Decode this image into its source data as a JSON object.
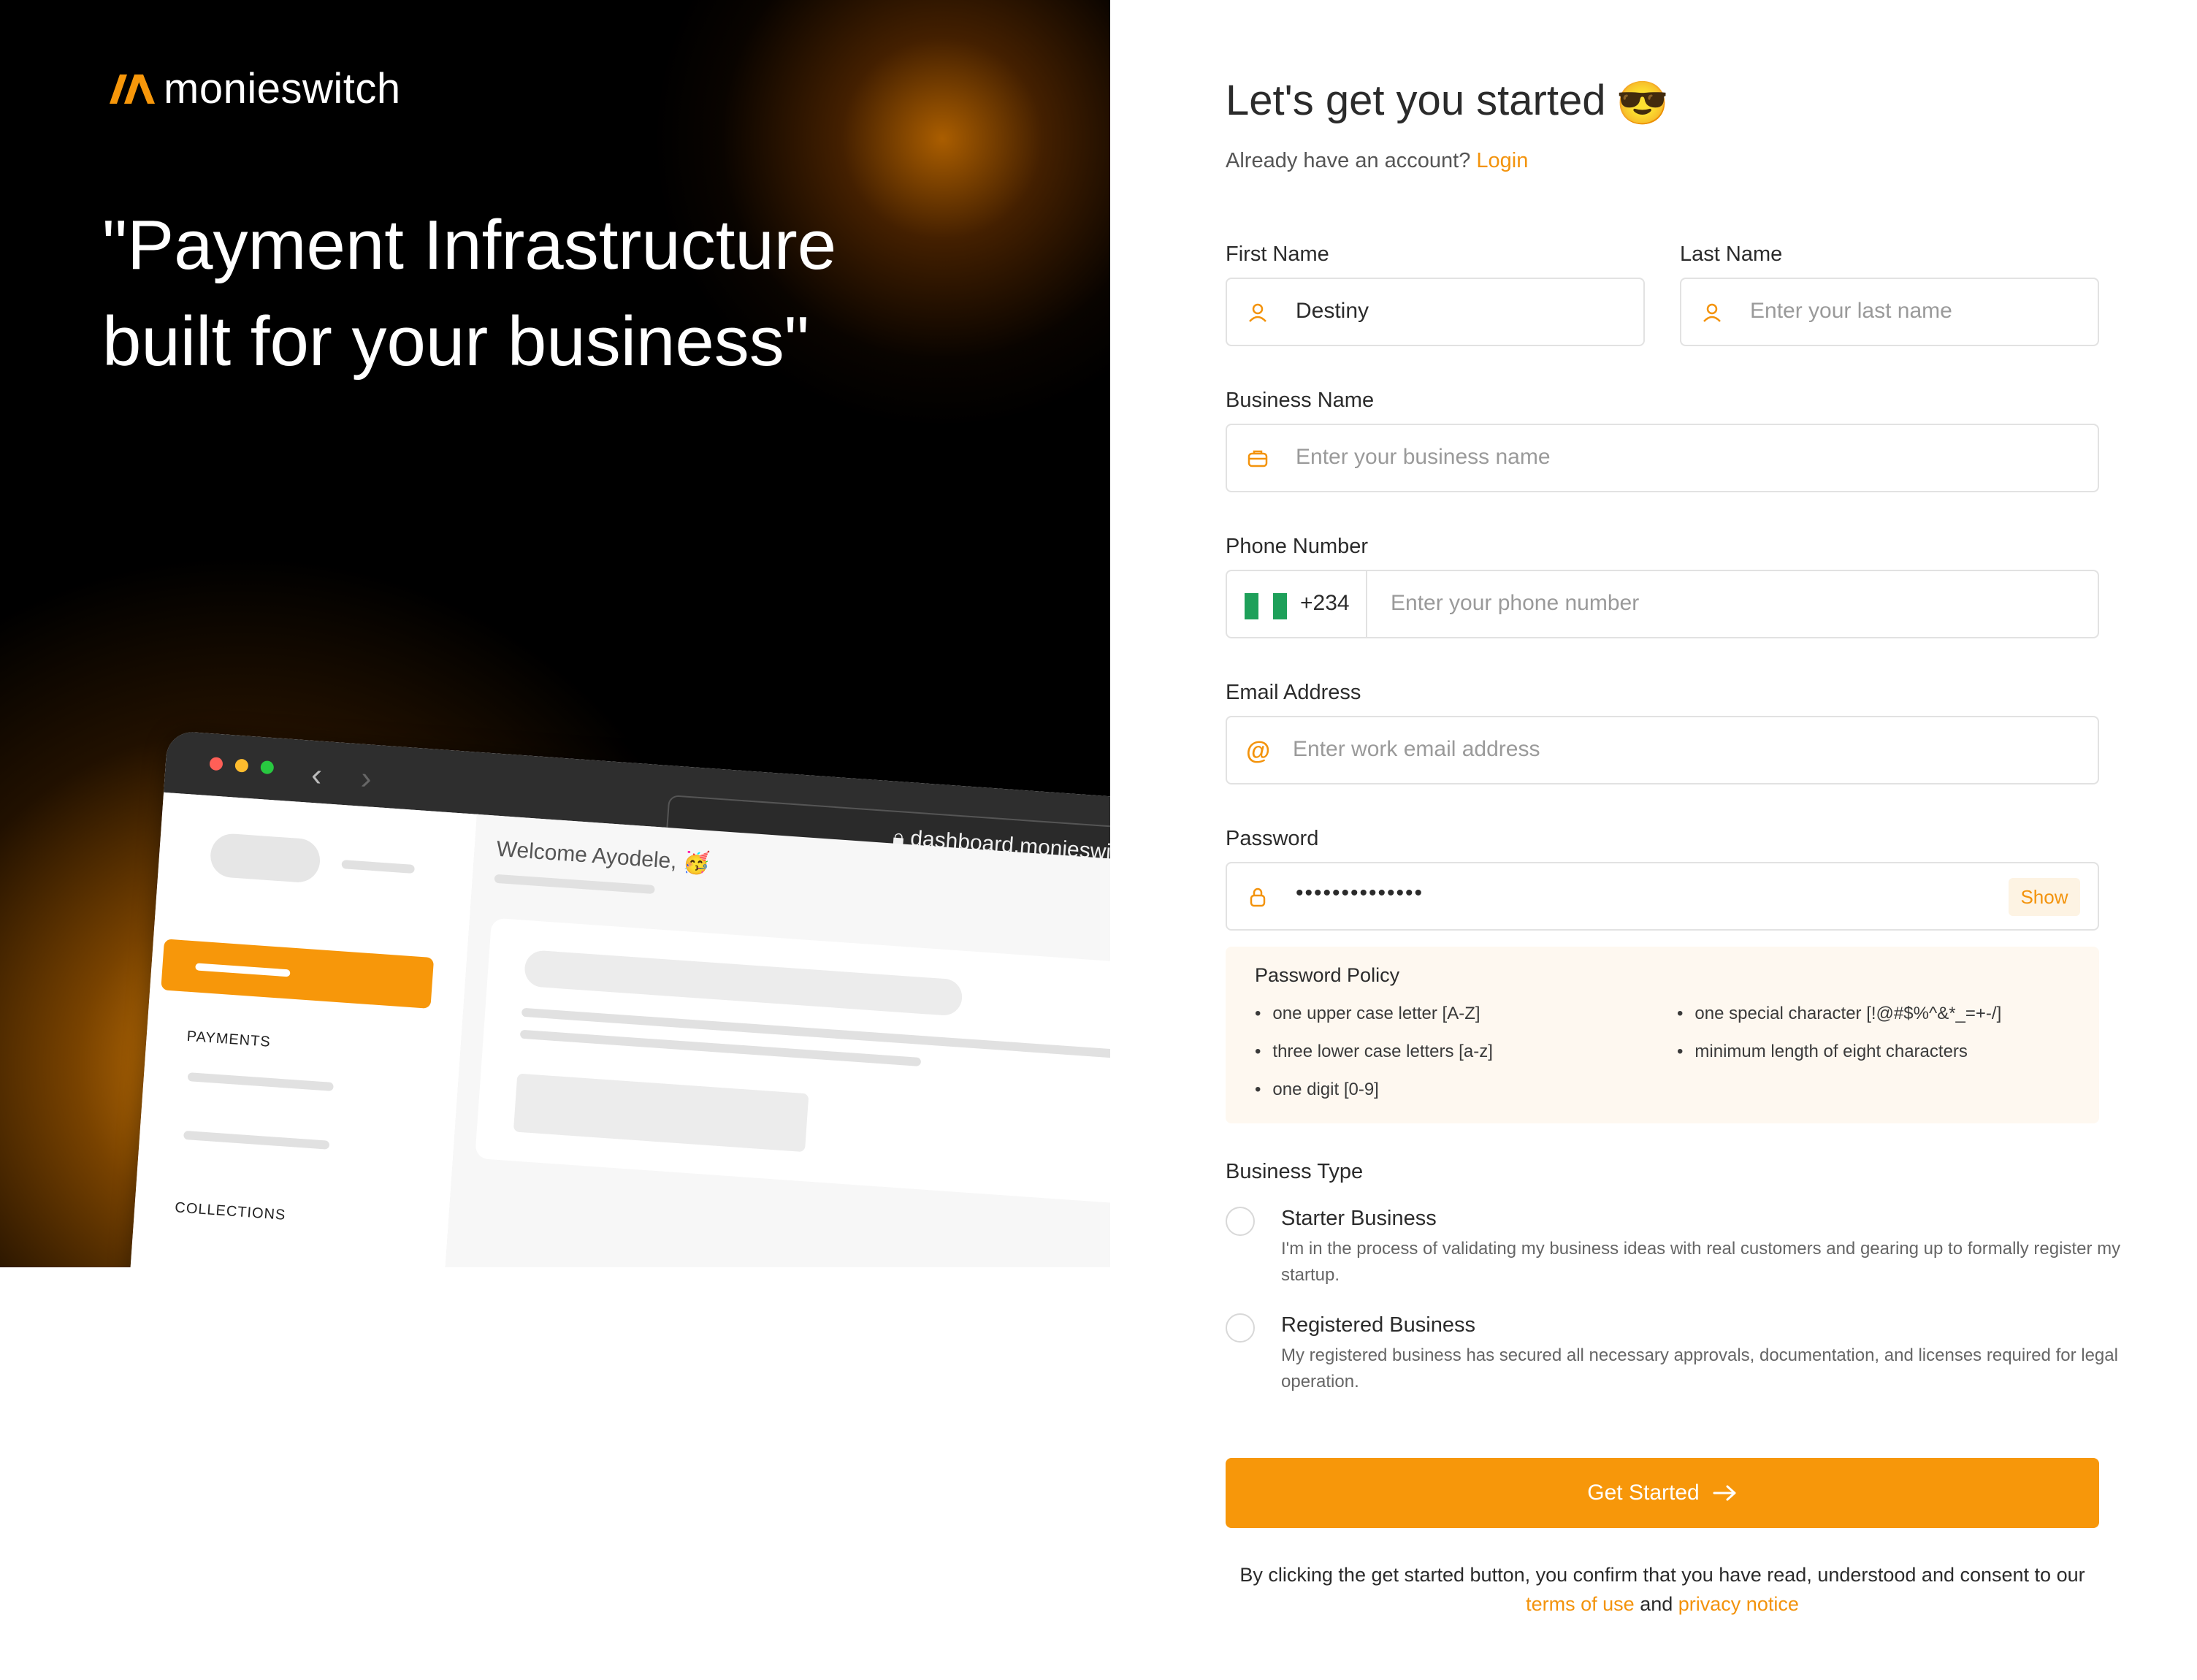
{
  "brand": {
    "name": "monieswitch",
    "accent": "#f7970a"
  },
  "hero": {
    "headline_line1": "\"Payment Infrastructure",
    "headline_line2": "built for your business\""
  },
  "mockup": {
    "url": "dashboard.monieswi",
    "welcome": "Welcome Ayodele, 🥳",
    "section1": "PAYMENTS",
    "section2": "COLLECTIONS"
  },
  "form": {
    "title": "Let's get you started",
    "title_emoji": "😎",
    "login_prompt": "Already have an account?",
    "login_link": "Login",
    "first_name": {
      "label": "First Name",
      "value": "Destiny"
    },
    "last_name": {
      "label": "Last Name",
      "placeholder": "Enter your last name"
    },
    "business_name": {
      "label": "Business Name",
      "placeholder": "Enter your business name"
    },
    "phone": {
      "label": "Phone Number",
      "country_code": "+234",
      "placeholder": "Enter your phone number"
    },
    "email": {
      "label": "Email Address",
      "placeholder": "Enter work email address"
    },
    "password": {
      "label": "Password",
      "value": "••••••••••••••",
      "show_label": "Show"
    },
    "policy": {
      "title": "Password Policy",
      "rules": [
        "one upper case letter [A-Z]",
        "three lower case letters [a-z]",
        "one digit [0-9]",
        "one special character [!@#$%^&*_=+-/]",
        "minimum length of eight characters"
      ]
    },
    "business_type": {
      "label": "Business Type",
      "options": [
        {
          "title": "Starter Business",
          "desc": "I'm in the process of validating my business ideas with real customers and gearing up to formally register my startup."
        },
        {
          "title": "Registered Business",
          "desc": "My registered business has secured all necessary approvals, documentation, and licenses required for legal operation."
        }
      ]
    },
    "cta": "Get Started",
    "consent_text": "By clicking the get started button, you confirm that you have read, understood and consent to our",
    "terms_link": "terms of use",
    "and_word": "and",
    "privacy_link": "privacy notice"
  }
}
